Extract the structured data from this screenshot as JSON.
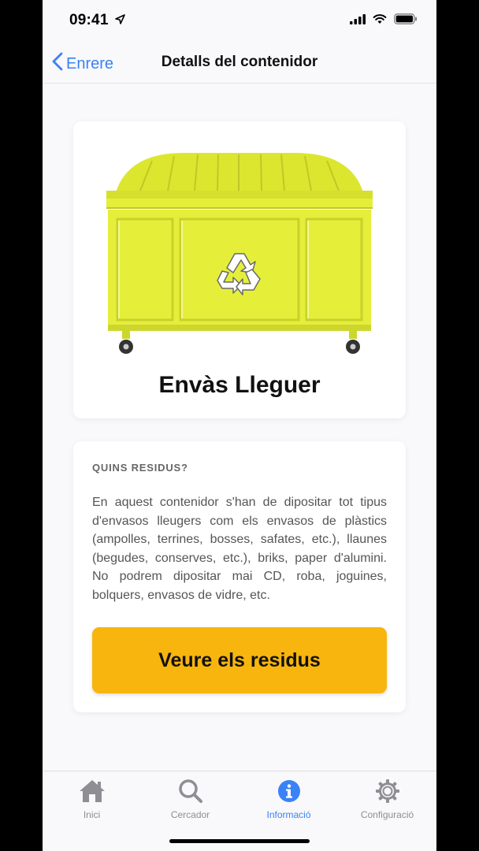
{
  "status_bar": {
    "time": "09:41"
  },
  "nav": {
    "back_label": "Enrere",
    "title": "Detalls del contenidor"
  },
  "container": {
    "name": "Envàs Lleguer",
    "color": "#e5ef3a",
    "icon": "recycle-icon"
  },
  "info": {
    "section_title": "QUINS RESIDUS?",
    "description": "En aquest contenidor s'han de dipositar tot tipus d'envasos lleugers com els envasos de plàstics (ampolles, terrines, bosses, safates, etc.), llaunes (begudes, conserves, etc.), briks, paper d'alumini. No podrem dipositar mai CD, roba, joguines, bolquers, envasos de vidre, etc.",
    "button_label": "Veure els residus"
  },
  "tabs": [
    {
      "label": "Inici",
      "icon": "home-icon",
      "active": false
    },
    {
      "label": "Cercador",
      "icon": "search-icon",
      "active": false
    },
    {
      "label": "Informació",
      "icon": "info-icon",
      "active": true
    },
    {
      "label": "Configuració",
      "icon": "gear-icon",
      "active": false
    }
  ],
  "colors": {
    "accent": "#3a82f7",
    "button": "#f8b50d",
    "inactive": "#8e8e93"
  }
}
